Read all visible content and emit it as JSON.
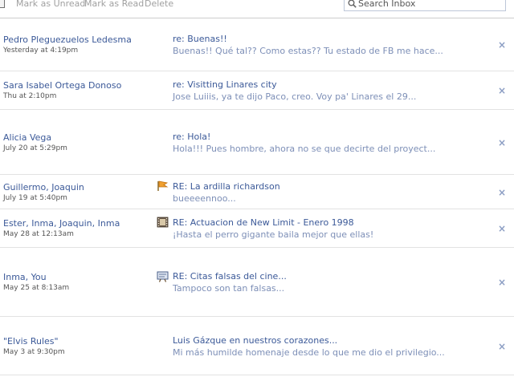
{
  "toolbar": {
    "mark_unread": "Mark as Unread",
    "mark_read": "Mark as Read",
    "delete": "Delete"
  },
  "search": {
    "placeholder": "Search Inbox"
  },
  "threads": [
    {
      "sender": "Pedro Pleguezuelos Ledesma",
      "date": "Yesterday at 4:19pm",
      "subject": "re: Buenas!!",
      "snippet": "Buenas!! Qué tal?? Como estas?? Tu estado de FB me hace...",
      "icon": "none",
      "delete": "×"
    },
    {
      "sender": "Sara Isabel Ortega Donoso",
      "date": "Thu at 2:10pm",
      "subject": "re: Visitting Linares city",
      "snippet": "Jose Luiiis, ya te dijo Paco, creo. Voy pa' Linares el 29...",
      "icon": "none",
      "delete": "×"
    },
    {
      "sender": "Alicia Vega",
      "date": "July 20 at 5:29pm",
      "subject": "re: Hola!",
      "snippet": "Hola!!! Pues hombre, ahora no se que decirte del proyect...",
      "icon": "none",
      "delete": "×"
    },
    {
      "sender": "Guillermo, Joaquin",
      "date": "July 19 at 5:40pm",
      "subject": "RE: La ardilla richardson",
      "snippet": "bueeeennoo...",
      "icon": "flag-icon",
      "delete": "×"
    },
    {
      "sender": "Ester, Inma, Joaquin, Inma",
      "date": "May 28 at 12:13am",
      "subject": "RE: Actuacion de New Limit - Enero 1998",
      "snippet": "¡Hasta el perro gigante baila mejor que ellas!",
      "icon": "film-icon",
      "delete": "×"
    },
    {
      "sender": "Inma, You",
      "date": "May 25 at 8:13am",
      "subject": "RE: Citas falsas del cine...",
      "snippet": "Tampoco son tan falsas...",
      "icon": "board-icon",
      "delete": "×"
    },
    {
      "sender": "\"Elvis Rules\"",
      "date": "May 3 at 9:30pm",
      "subject": "Luis Gázque en nuestros corazones...",
      "snippet": "Mi más humilde homenaje desde lo que me dio el privilegio...",
      "icon": "none",
      "delete": "×"
    }
  ]
}
